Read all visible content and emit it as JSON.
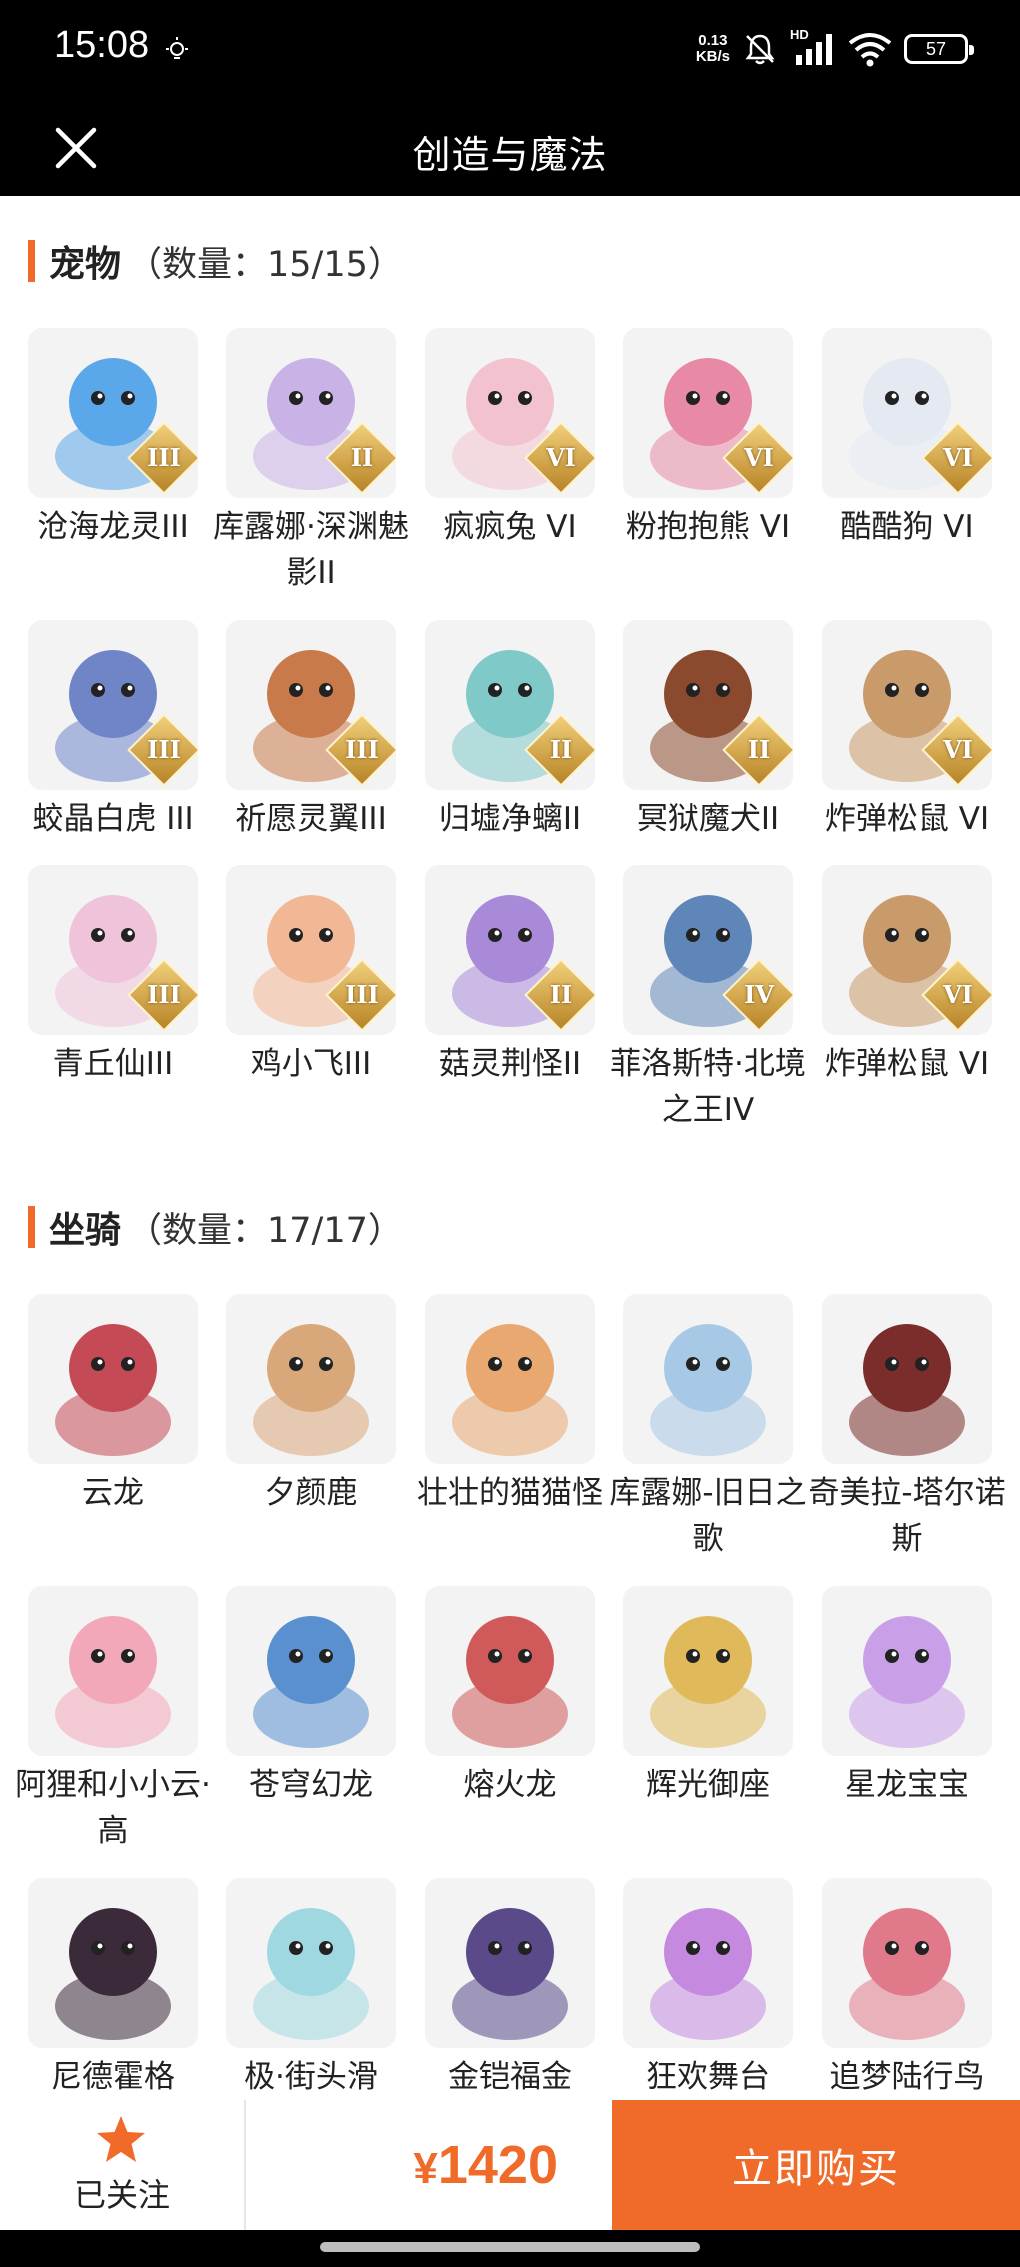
{
  "status_bar": {
    "time": "15:08",
    "net_speed_value": "0.13",
    "net_speed_unit": "KB/s",
    "battery": "57",
    "network_label": "HD",
    "icons": [
      "lightbulb-icon",
      "mute-icon",
      "signal-icon",
      "wifi-icon",
      "battery-icon"
    ]
  },
  "nav": {
    "title": "创造与魔法",
    "close_icon": "close-icon"
  },
  "colors": {
    "accent": "#f06a2a",
    "tier_badge": "#d4a548",
    "thumb_bg": "#f3f3f3"
  },
  "pets": {
    "title": "宠物",
    "count": "（数量：15/15）",
    "items": [
      {
        "label": "沧海龙灵III",
        "tier": "III",
        "color": "#5aa7ea"
      },
      {
        "label": "库露娜·深渊魅影II",
        "tier": "II",
        "color": "#c9b3e6"
      },
      {
        "label": "疯疯兔 VI",
        "tier": "VI",
        "color": "#f2c3cf"
      },
      {
        "label": "粉抱抱熊 VI",
        "tier": "VI",
        "color": "#e88aa6"
      },
      {
        "label": "酷酷狗 VI",
        "tier": "VI",
        "color": "#e4e9f2"
      },
      {
        "label": "蛟晶白虎 III",
        "tier": "III",
        "color": "#6f85c8"
      },
      {
        "label": "祈愿灵翼III",
        "tier": "III",
        "color": "#c97a4a"
      },
      {
        "label": "归墟净螭II",
        "tier": "II",
        "color": "#7fc9c8"
      },
      {
        "label": "冥狱魔犬II",
        "tier": "II",
        "color": "#8b4a2e"
      },
      {
        "label": "炸弹松鼠 VI",
        "tier": "VI",
        "color": "#c99a6a"
      },
      {
        "label": "青丘仙III",
        "tier": "III",
        "color": "#efc3d9"
      },
      {
        "label": "鸡小飞III",
        "tier": "III",
        "color": "#f2b896"
      },
      {
        "label": "菇灵荆怪II",
        "tier": "II",
        "color": "#a98ad9"
      },
      {
        "label": "菲洛斯特·北境之王IV",
        "tier": "IV",
        "color": "#5f86b8"
      },
      {
        "label": "炸弹松鼠 VI",
        "tier": "VI",
        "color": "#c99a6a"
      }
    ]
  },
  "mounts": {
    "title": "坐骑",
    "count": "（数量：17/17）",
    "items": [
      {
        "label": "云龙",
        "color": "#c44a55"
      },
      {
        "label": "夕颜鹿",
        "color": "#d8a77a"
      },
      {
        "label": "壮壮的猫猫怪",
        "color": "#e8a870"
      },
      {
        "label": "库露娜-旧日之歌",
        "color": "#a7c9e6"
      },
      {
        "label": "奇美拉-塔尔诺斯",
        "color": "#7a2d2a"
      },
      {
        "label": "阿狸和小小云·高",
        "color": "#f2a8b8"
      },
      {
        "label": "苍穹幻龙",
        "color": "#5a8fd0"
      },
      {
        "label": "熔火龙",
        "color": "#d05a5a"
      },
      {
        "label": "辉光御座",
        "color": "#e0b95a"
      },
      {
        "label": "星龙宝宝",
        "color": "#c9a0e8"
      },
      {
        "label": "尼德霍格",
        "color": "#3a2a3a"
      },
      {
        "label": "极·街头滑",
        "color": "#9fd8e0"
      },
      {
        "label": "金铠福金",
        "color": "#5a4a8a"
      },
      {
        "label": "狂欢舞台",
        "color": "#c58ae0"
      },
      {
        "label": "追梦陆行鸟",
        "color": "#e07a8a"
      }
    ]
  },
  "footer": {
    "follow_label": "已关注",
    "price_symbol": "¥",
    "price_value": "1420",
    "buy_label": "立即购买"
  }
}
